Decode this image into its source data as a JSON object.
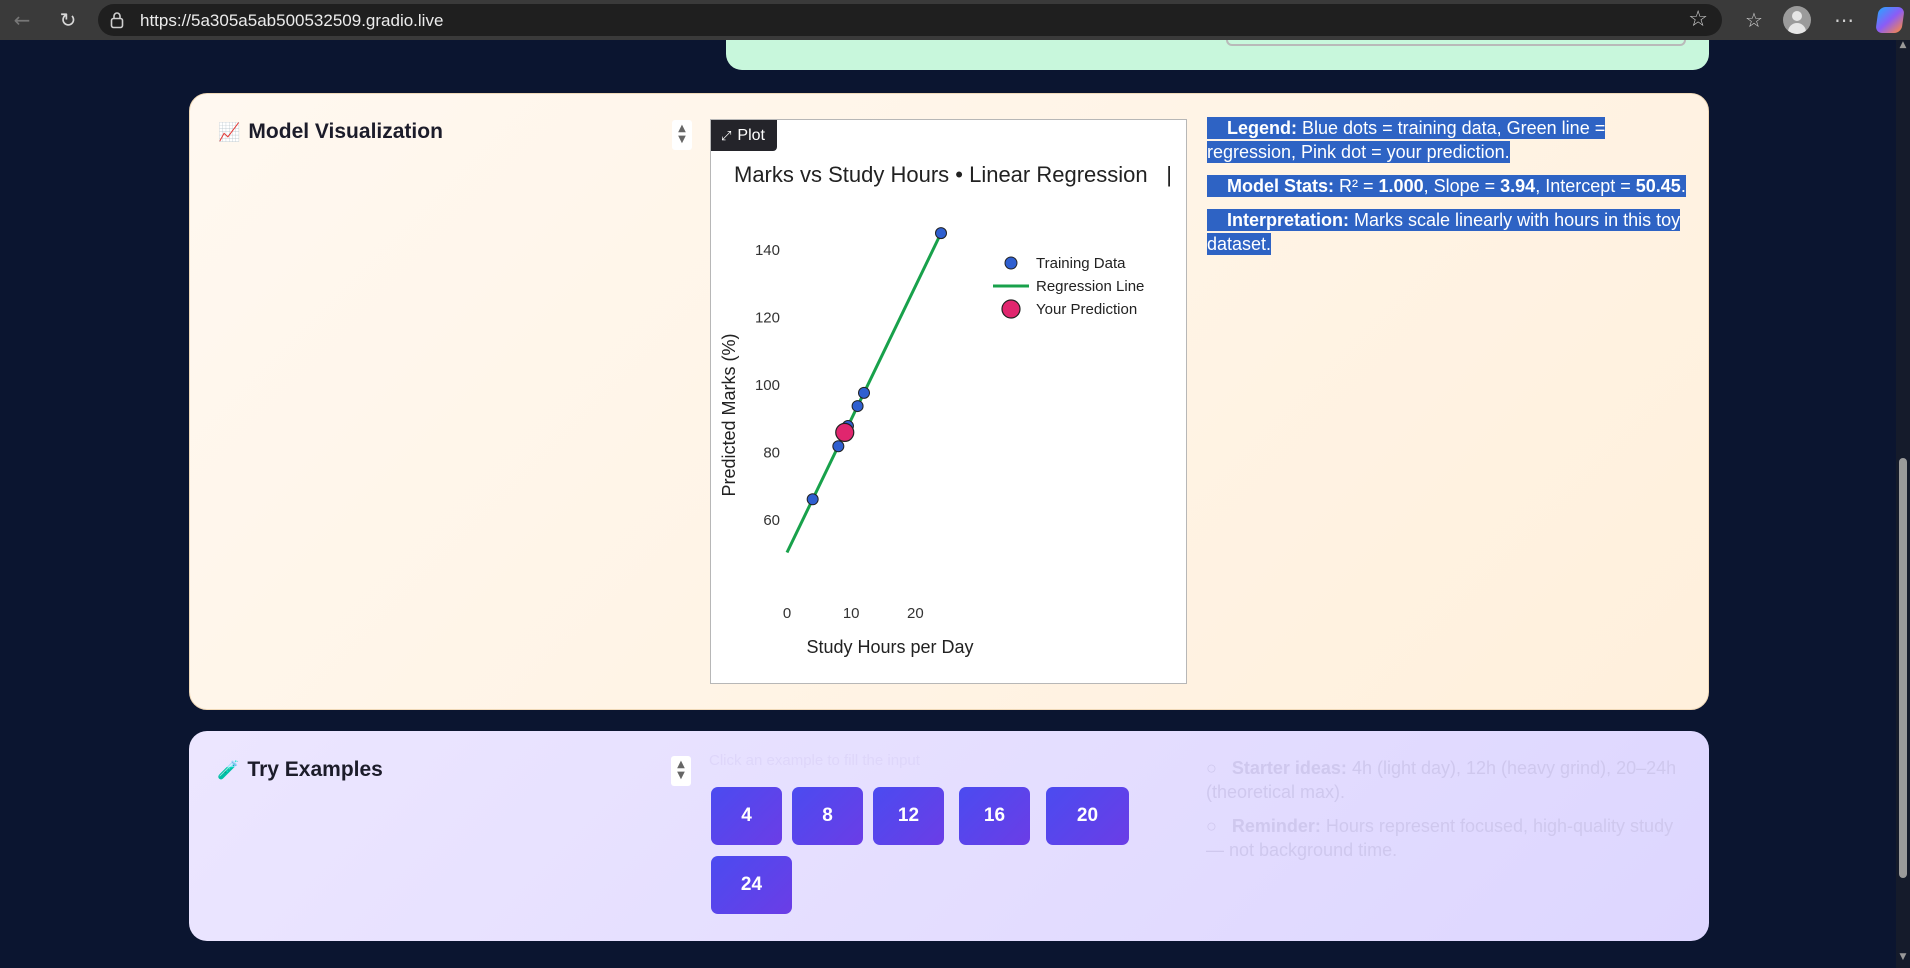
{
  "browser": {
    "url": "https://5a305a5ab500532509.gradio.live",
    "icons": [
      "back-icon",
      "reload-icon",
      "lock-icon",
      "star-icon",
      "favorites-icon",
      "profile-avatar",
      "more-icon",
      "copilot-icon"
    ]
  },
  "visualization": {
    "emoji": "📈",
    "title": "Model Visualization",
    "plot_tag": "Plot",
    "notes": {
      "legend_label": "Legend:",
      "legend_text": " Blue dots = training data, Green line = regression, Pink dot = your prediction.",
      "stats_label": "Model Stats:",
      "stats_r2_prefix": " R² = ",
      "stats_r2": "1.000",
      "stats_slope_prefix": ", Slope = ",
      "stats_slope": "3.94",
      "stats_intercept_prefix": ", Intercept = ",
      "stats_intercept": "50.45",
      "stats_end": ".",
      "interp_label": "Interpretation:",
      "interp_text": " Marks scale linearly with hours in this toy dataset."
    }
  },
  "chart_data": {
    "type": "scatter",
    "title": "Marks vs Study Hours • Linear Regression",
    "title_suffix": "|",
    "xlabel": "Study Hours per Day",
    "ylabel": "Predicted Marks (%)",
    "xlim": [
      0,
      24
    ],
    "ylim": [
      50,
      148
    ],
    "xticks": [
      0,
      10,
      20
    ],
    "yticks": [
      60,
      80,
      100,
      120,
      140
    ],
    "grid": false,
    "legend_position": "top-right",
    "series": [
      {
        "name": "Training Data",
        "kind": "points",
        "color": "#2f5fd0",
        "x": [
          4,
          8,
          9.5,
          11,
          12,
          24
        ],
        "y": [
          66.2,
          81.9,
          87.9,
          93.8,
          97.7,
          145
        ]
      },
      {
        "name": "Regression Line",
        "kind": "line",
        "color": "#18a14b",
        "x": [
          0,
          24
        ],
        "y": [
          50.45,
          145
        ]
      },
      {
        "name": "Your Prediction",
        "kind": "point",
        "color": "#e0266e",
        "x": [
          9
        ],
        "y": [
          86
        ]
      }
    ]
  },
  "examples": {
    "emoji": "🧪",
    "title": "Try Examples",
    "caption": "Click an example to fill the input",
    "buttons": [
      "4",
      "8",
      "12",
      "16",
      "20",
      "24"
    ],
    "notes": {
      "starter_label": "Starter ideas:",
      "starter_text": " 4h (light day), 12h (heavy grind), 20–24h (theoretical max).",
      "reminder_label": "Reminder:",
      "reminder_text": " Hours represent focused, high-quality study — not background time."
    }
  }
}
